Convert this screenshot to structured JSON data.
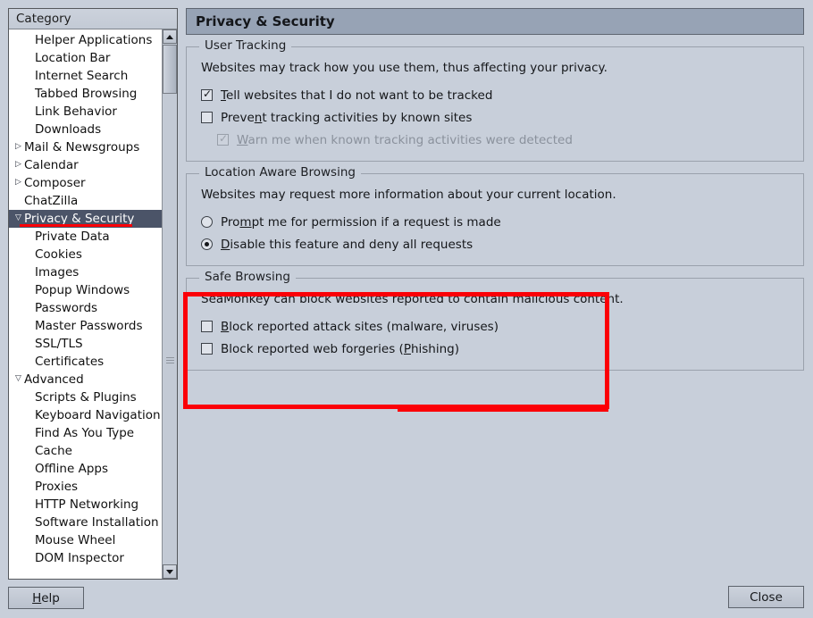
{
  "window": {
    "title": "Privacy & Security"
  },
  "sidebar": {
    "header_label": "Category",
    "items": [
      {
        "label": "Helper Applications",
        "level": "child",
        "twisty": "none",
        "selected": false
      },
      {
        "label": "Location Bar",
        "level": "child",
        "twisty": "none",
        "selected": false
      },
      {
        "label": "Internet Search",
        "level": "child",
        "twisty": "none",
        "selected": false
      },
      {
        "label": "Tabbed Browsing",
        "level": "child",
        "twisty": "none",
        "selected": false
      },
      {
        "label": "Link Behavior",
        "level": "child",
        "twisty": "none",
        "selected": false
      },
      {
        "label": "Downloads",
        "level": "child",
        "twisty": "none",
        "selected": false
      },
      {
        "label": "Mail & Newsgroups",
        "level": "root",
        "twisty": "collapsed",
        "selected": false
      },
      {
        "label": "Calendar",
        "level": "root",
        "twisty": "collapsed",
        "selected": false
      },
      {
        "label": "Composer",
        "level": "root",
        "twisty": "collapsed",
        "selected": false
      },
      {
        "label": "ChatZilla",
        "level": "root",
        "twisty": "none",
        "selected": false
      },
      {
        "label": "Privacy & Security",
        "level": "root",
        "twisty": "expanded",
        "selected": true
      },
      {
        "label": "Private Data",
        "level": "child",
        "twisty": "none",
        "selected": false
      },
      {
        "label": "Cookies",
        "level": "child",
        "twisty": "none",
        "selected": false
      },
      {
        "label": "Images",
        "level": "child",
        "twisty": "none",
        "selected": false
      },
      {
        "label": "Popup Windows",
        "level": "child",
        "twisty": "none",
        "selected": false
      },
      {
        "label": "Passwords",
        "level": "child",
        "twisty": "none",
        "selected": false
      },
      {
        "label": "Master Passwords",
        "level": "child",
        "twisty": "none",
        "selected": false
      },
      {
        "label": "SSL/TLS",
        "level": "child",
        "twisty": "none",
        "selected": false
      },
      {
        "label": "Certificates",
        "level": "child",
        "twisty": "none",
        "selected": false
      },
      {
        "label": "Advanced",
        "level": "root",
        "twisty": "expanded",
        "selected": false
      },
      {
        "label": "Scripts & Plugins",
        "level": "child",
        "twisty": "none",
        "selected": false
      },
      {
        "label": "Keyboard Navigation",
        "level": "child",
        "twisty": "none",
        "selected": false
      },
      {
        "label": "Find As You Type",
        "level": "child",
        "twisty": "none",
        "selected": false
      },
      {
        "label": "Cache",
        "level": "child",
        "twisty": "none",
        "selected": false
      },
      {
        "label": "Offline Apps",
        "level": "child",
        "twisty": "none",
        "selected": false
      },
      {
        "label": "Proxies",
        "level": "child",
        "twisty": "none",
        "selected": false
      },
      {
        "label": "HTTP Networking",
        "level": "child",
        "twisty": "none",
        "selected": false
      },
      {
        "label": "Software Installation",
        "level": "child",
        "twisty": "none",
        "selected": false
      },
      {
        "label": "Mouse Wheel",
        "level": "child",
        "twisty": "none",
        "selected": false
      },
      {
        "label": "DOM Inspector",
        "level": "child",
        "twisty": "none",
        "selected": false
      }
    ],
    "scrollbar": {
      "up_icon": "scroll-up-arrow-icon",
      "down_icon": "scroll-down-arrow-icon"
    }
  },
  "groups": {
    "user_tracking": {
      "legend": "User Tracking",
      "description": "Websites may track how you use them, thus affecting your privacy.",
      "options": [
        {
          "type": "checkbox",
          "label": "Tell websites that I do not want to be tracked",
          "checked": true,
          "disabled": false,
          "indented": false
        },
        {
          "type": "checkbox",
          "label": "Prevent tracking activities by known sites",
          "checked": false,
          "disabled": false,
          "indented": false
        },
        {
          "type": "checkbox",
          "label": "Warn me when known tracking activities were detected",
          "checked": true,
          "disabled": true,
          "indented": true
        }
      ]
    },
    "location_aware": {
      "legend": "Location Aware Browsing",
      "description": "Websites may request more information about your current location.",
      "options": [
        {
          "type": "radio",
          "label": "Prompt me for permission if a request is made",
          "checked": false,
          "disabled": false,
          "indented": false
        },
        {
          "type": "radio",
          "label": "Disable this feature and deny all requests",
          "checked": true,
          "disabled": false,
          "indented": false
        }
      ]
    },
    "safe_browsing": {
      "legend": "Safe Browsing",
      "description": "SeaMonkey can block websites reported to contain malicious content.",
      "options": [
        {
          "type": "checkbox",
          "label": "Block reported attack sites (malware, viruses)",
          "checked": false,
          "disabled": false,
          "indented": false
        },
        {
          "type": "checkbox",
          "label": "Block reported web forgeries (Phishing)",
          "checked": false,
          "disabled": false,
          "indented": false
        }
      ]
    }
  },
  "buttons": {
    "help_label": "Help",
    "close_label": "Close"
  },
  "annotations": {
    "highlight_color": "#fb0007",
    "highlight_target": "Safe Browsing",
    "underline_target": "Privacy & Security"
  }
}
